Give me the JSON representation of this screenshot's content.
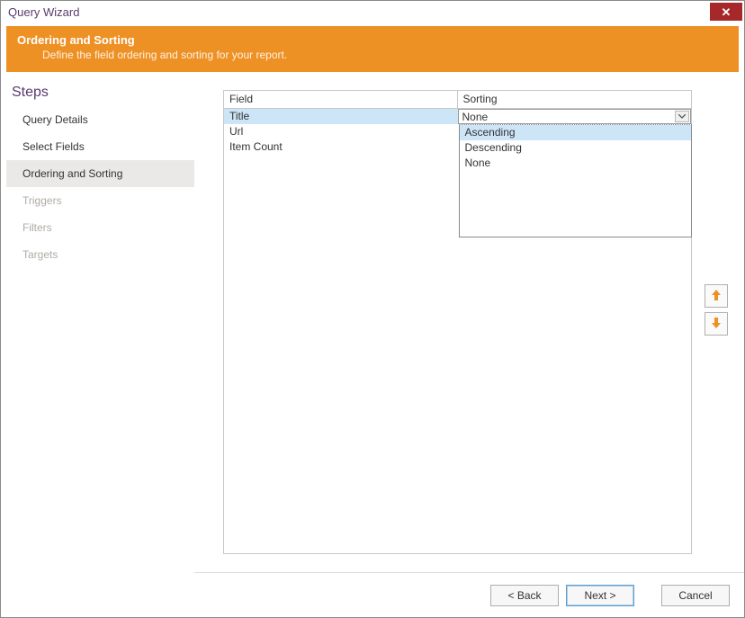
{
  "window": {
    "title": "Query Wizard"
  },
  "header": {
    "title": "Ordering and Sorting",
    "description": "Define the field ordering and sorting for your report."
  },
  "sidebar": {
    "heading": "Steps",
    "items": [
      {
        "label": "Query Details",
        "active": false,
        "disabled": false
      },
      {
        "label": "Select Fields",
        "active": false,
        "disabled": false
      },
      {
        "label": "Ordering and Sorting",
        "active": true,
        "disabled": false
      },
      {
        "label": "Triggers",
        "active": false,
        "disabled": true
      },
      {
        "label": "Filters",
        "active": false,
        "disabled": true
      },
      {
        "label": "Targets",
        "active": false,
        "disabled": true
      }
    ]
  },
  "grid": {
    "columns": {
      "field": "Field",
      "sorting": "Sorting"
    },
    "rows": [
      {
        "field": "Title",
        "sorting": "None",
        "selected": true
      },
      {
        "field": "Url",
        "sorting": ""
      },
      {
        "field": "Item Count",
        "sorting": ""
      }
    ],
    "dropdown": {
      "options": [
        {
          "label": "Ascending",
          "selected": true
        },
        {
          "label": "Descending",
          "selected": false
        },
        {
          "label": "None",
          "selected": false
        }
      ]
    }
  },
  "footer": {
    "back": "< Back",
    "next": "Next >",
    "cancel": "Cancel"
  }
}
